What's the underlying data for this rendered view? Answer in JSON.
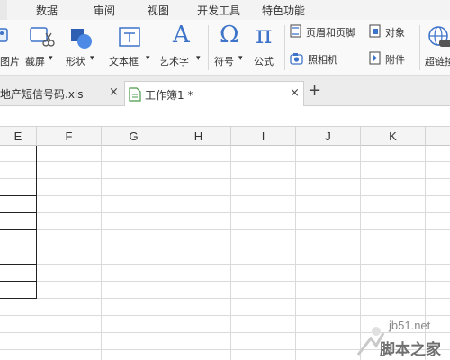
{
  "menu": {
    "items": [
      "数据",
      "审阅",
      "视图",
      "开发工具",
      "特色功能"
    ]
  },
  "ribbon": {
    "picture_label": "图片",
    "screenshot_label": "截屏",
    "shapes_label": "形状",
    "textbox_label": "文本框",
    "wordart_label": "艺术字",
    "symbol_label": "符号",
    "formula_label": "公式",
    "header_footer_label": "页眉和页脚",
    "object_label": "对象",
    "camera_label": "照相机",
    "attachment_label": "附件",
    "hyperlink_label": "超链接",
    "dropdown_glyph": "▾",
    "omega_glyph": "Ω",
    "pi_glyph": "π",
    "a_glyph": "A"
  },
  "tabs": [
    {
      "label": "地产短信号码.xls",
      "active": false
    },
    {
      "label": "工作簿1 *",
      "active": true
    }
  ],
  "tab_close_glyph": "×",
  "add_tab_glyph": "+",
  "grid": {
    "columns": [
      "E",
      "F",
      "G",
      "H",
      "I",
      "J",
      "K"
    ]
  },
  "watermark": {
    "site": "jb51.net",
    "name": "脚本之家"
  },
  "colors": {
    "accent_blue": "#3d73c9",
    "menu_bg": "#f3f3f3",
    "ribbon_bg": "#f9f9f9",
    "grid_line": "#dadada",
    "cell_border": "#222222"
  }
}
